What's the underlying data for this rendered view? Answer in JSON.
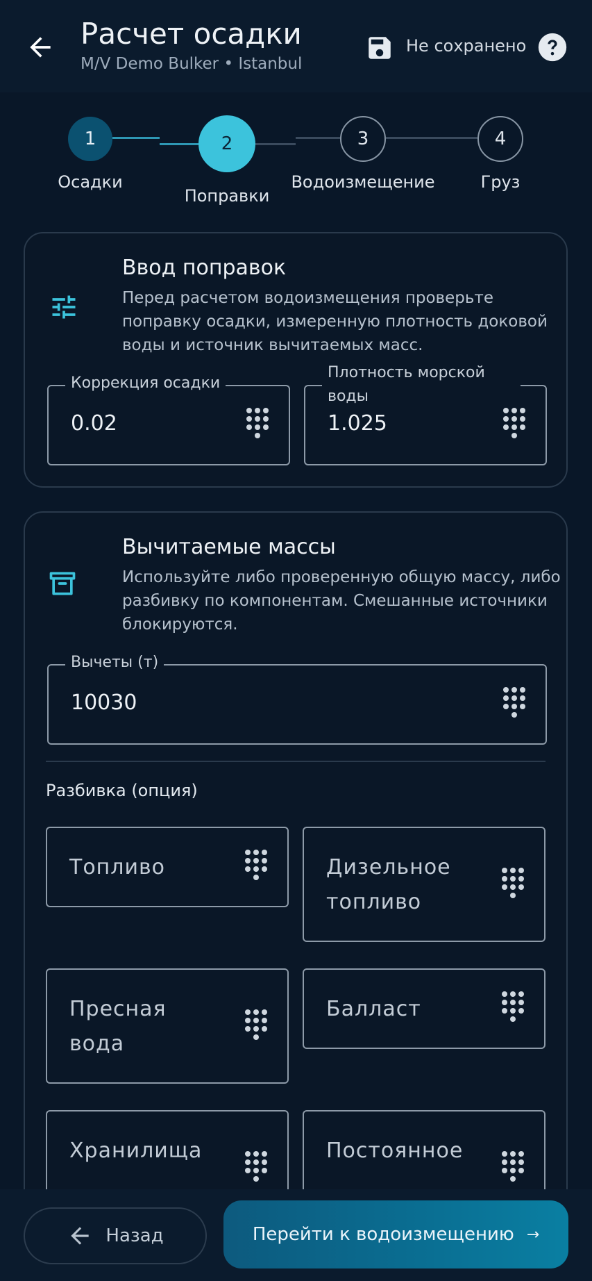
{
  "header": {
    "title": "Расчет осадки",
    "subtitle": "M/V Demo Bulker • Istanbul",
    "save_status": "Не сохранено"
  },
  "stepper": {
    "active": 2,
    "steps": [
      {
        "number": "1",
        "label": "Осадки"
      },
      {
        "number": "2",
        "label": "Поправки"
      },
      {
        "number": "3",
        "label": "Водоизмещение"
      },
      {
        "number": "4",
        "label": "Груз"
      }
    ]
  },
  "corrections": {
    "title": "Ввод поправок",
    "description": "Перед расчетом водоизмещения проверьте поправку осадки, измеренную плотность доковой воды и источник вычитаемых масс.",
    "draft_correction": {
      "label": "Коррекция осадки",
      "value": "0.02"
    },
    "sea_density": {
      "label": "Плотность морской воды",
      "value": "1.025"
    }
  },
  "deductibles": {
    "title": "Вычитаемые массы",
    "description": "Используйте либо проверенную общую массу, либо разбивку по компонентам. Смешанные источники блокируются.",
    "deductions": {
      "label": "Вычеты (т)",
      "value": "10030"
    },
    "breakdown_label": "Разбивка (опция)",
    "breakdown": [
      {
        "placeholder": "Топливо"
      },
      {
        "placeholder": "Дизельное топливо"
      },
      {
        "placeholder": "Пресная вода"
      },
      {
        "placeholder": "Балласт"
      },
      {
        "placeholder": "Хранилища"
      },
      {
        "placeholder": "Постоянное"
      }
    ]
  },
  "footer": {
    "back_label": "Назад",
    "next_label": "Перейти к водоизмещению",
    "next_arrow": "→"
  },
  "colors": {
    "background": "#091728",
    "accent": "#3cc3dc",
    "step_done": "#0b5170",
    "button_primary": "#0a6f93"
  }
}
